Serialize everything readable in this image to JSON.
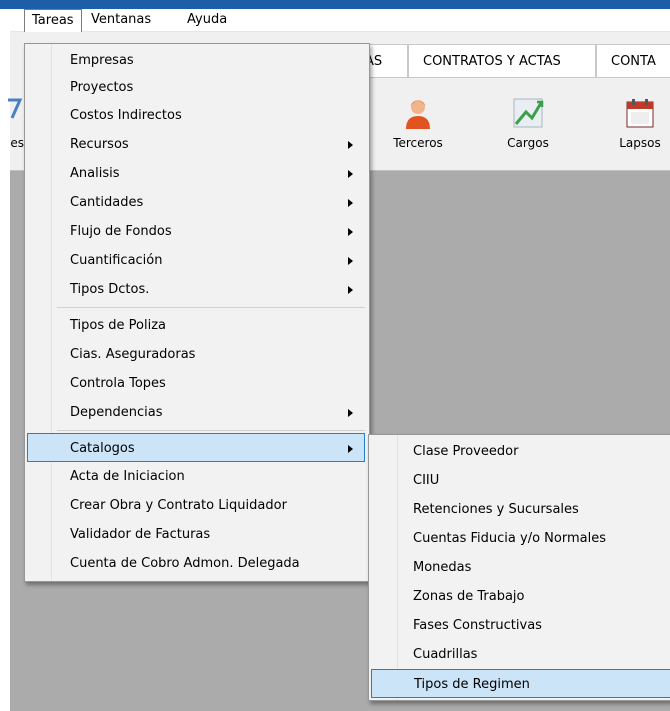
{
  "menubar": {
    "items": [
      {
        "label": "Tareas"
      },
      {
        "label": "Ventanas"
      },
      {
        "label": "Ayuda"
      }
    ]
  },
  "tabs": [
    {
      "label": "AS"
    },
    {
      "label": "CONTRATOS Y ACTAS"
    },
    {
      "label": "CONTA"
    }
  ],
  "toolbar": {
    "items": [
      {
        "label": "es",
        "icon": "partial-icon"
      },
      {
        "label": "Terceros",
        "icon": "person-icon"
      },
      {
        "label": "Cargos",
        "icon": "chart-icon"
      },
      {
        "label": "Lapsos",
        "icon": "calendar-icon"
      }
    ]
  },
  "menu": {
    "items": [
      {
        "label": "Empresas",
        "submenu": false
      },
      {
        "label": "Proyectos",
        "submenu": false
      },
      {
        "label": "Costos Indirectos",
        "submenu": false
      },
      {
        "label": "Recursos",
        "submenu": true
      },
      {
        "label": "Analisis",
        "submenu": true
      },
      {
        "label": "Cantidades",
        "submenu": true
      },
      {
        "label": "Flujo de Fondos",
        "submenu": true
      },
      {
        "label": "Cuantificación",
        "submenu": true
      },
      {
        "label": "Tipos Dctos.",
        "submenu": true
      },
      {
        "label": "Tipos de Poliza",
        "submenu": false
      },
      {
        "label": "Cias. Aseguradoras",
        "submenu": false
      },
      {
        "label": "Controla Topes",
        "submenu": false
      },
      {
        "label": "Dependencias",
        "submenu": true
      },
      {
        "label": "Catalogos",
        "submenu": true
      },
      {
        "label": "Acta de Iniciacion",
        "submenu": false
      },
      {
        "label": "Crear Obra y Contrato Liquidador",
        "submenu": false
      },
      {
        "label": "Validador de Facturas",
        "submenu": false
      },
      {
        "label": "Cuenta de Cobro Admon. Delegada",
        "submenu": false
      }
    ]
  },
  "submenu": {
    "items": [
      {
        "label": "Clase Proveedor"
      },
      {
        "label": "CIIU"
      },
      {
        "label": "Retenciones y Sucursales"
      },
      {
        "label": "Cuentas Fiducia y/o Normales"
      },
      {
        "label": "Monedas"
      },
      {
        "label": "Zonas de Trabajo"
      },
      {
        "label": "Fases Constructivas"
      },
      {
        "label": "Cuadrillas"
      },
      {
        "label": "Tipos de Regimen"
      }
    ]
  },
  "colors": {
    "titlebar": "#1c5fa8",
    "highlight": "#cce4f7",
    "highlight_border": "#1e7fd6",
    "workspace": "#ababab"
  }
}
